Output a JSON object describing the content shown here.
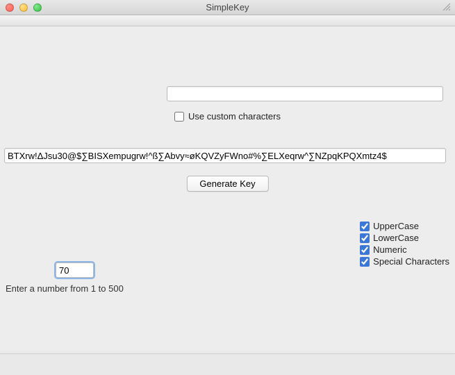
{
  "window": {
    "title": "SimpleKey"
  },
  "customChars": {
    "value": "",
    "label": "Use custom characters",
    "checked": false
  },
  "generatedKey": "BTXrw!ΔJsu30@$∑BISXempugrw!^ß∑Abvy≈øKQVZyFWno#%∑ELXeqrw^∑NZpqKPQXmtz4$",
  "buttons": {
    "generate": "Generate Key"
  },
  "options": {
    "uppercase": {
      "label": "UpperCase",
      "checked": true
    },
    "lowercase": {
      "label": "LowerCase",
      "checked": true
    },
    "numeric": {
      "label": "Numeric",
      "checked": true
    },
    "special": {
      "label": "Special Characters",
      "checked": true
    }
  },
  "length": {
    "value": "70",
    "hint": "Enter a number from 1 to 500"
  }
}
